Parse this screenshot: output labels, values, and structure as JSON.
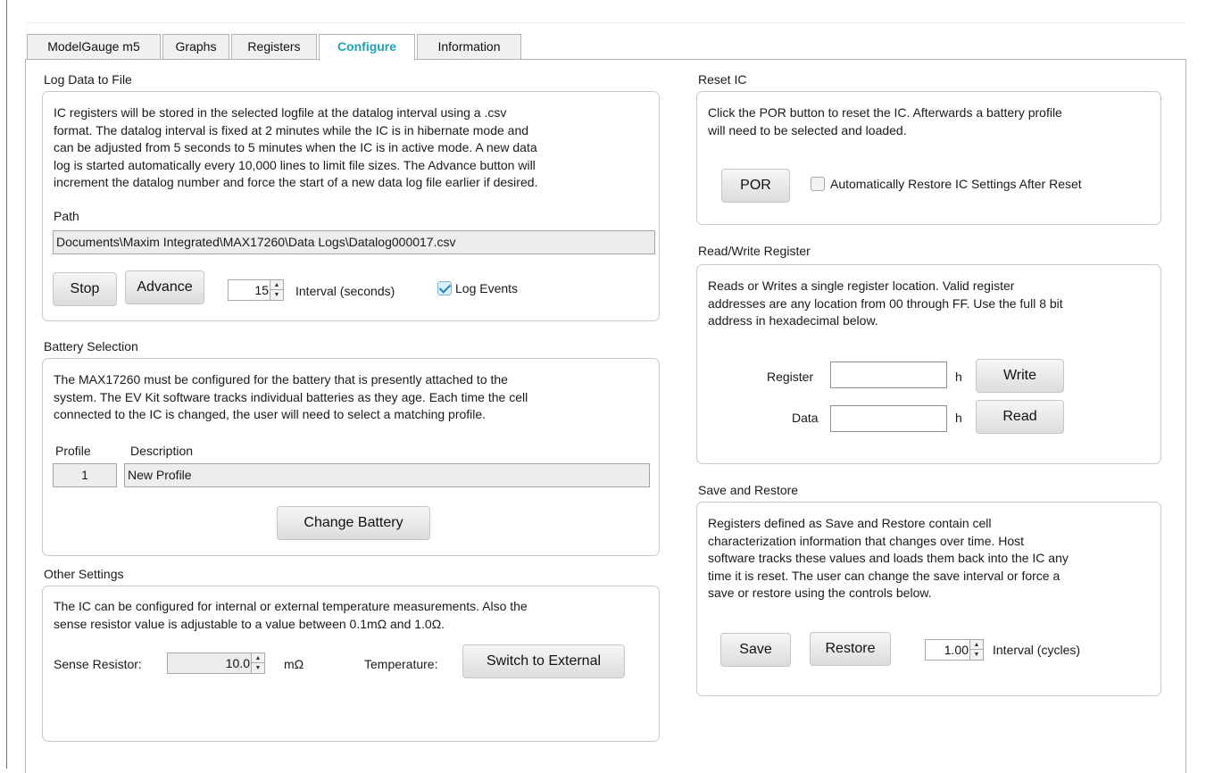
{
  "tabs": [
    "ModelGauge m5",
    "Graphs",
    "Registers",
    "Configure",
    "Information"
  ],
  "active_tab": "Configure",
  "log": {
    "title": "Log Data to File",
    "lines": [
      "IC registers will be stored in the selected logfile at the datalog interval using a .csv",
      "format. The datalog interval is fixed at 2 minutes while the IC is in hibernate mode and",
      "can be adjusted from 5 seconds to 5 minutes when the IC is in active mode. A new data",
      "log is started automatically every 10,000 lines to limit file sizes. The Advance button will",
      "increment the datalog number and force the start of a new data log file earlier if desired."
    ],
    "path_label": "Path",
    "path_value": "Documents\\Maxim Integrated\\MAX17260\\Data Logs\\Datalog000017.csv",
    "stop_label": "Stop",
    "advance_label": "Advance",
    "interval_value": "15",
    "interval_label": "Interval (seconds)",
    "log_events_label": "Log Events",
    "log_events_checked": true
  },
  "battery": {
    "title": "Battery Selection",
    "lines": [
      "The MAX17260 must be configured for the battery that is presently attached to the",
      "system. The EV Kit software tracks individual batteries as they age. Each time the cell",
      "connected to the IC is changed, the user will need to select a matching profile."
    ],
    "profile_header": "Profile",
    "description_header": "Description",
    "profile_value": "1",
    "description_value": "New Profile",
    "change_label": "Change Battery"
  },
  "other": {
    "title": "Other Settings",
    "lines": [
      "The IC can be configured for internal or external temperature measurements. Also the",
      "sense resistor value is adjustable to a value between 0.1mΩ and 1.0Ω."
    ],
    "sense_label": "Sense Resistor:",
    "sense_value": "10.0",
    "sense_unit": "mΩ",
    "temp_label": "Temperature:",
    "switch_label": "Switch to External"
  },
  "reset": {
    "title": "Reset IC",
    "lines": [
      "Click the POR button to reset the IC. Afterwards a battery profile",
      "will need to be selected and loaded."
    ],
    "por_label": "POR",
    "auto_restore_label": "Automatically Restore IC Settings After Reset",
    "auto_restore_checked": false
  },
  "rw": {
    "title": "Read/Write Register",
    "lines": [
      "Reads or Writes a single register location. Valid register",
      "addresses are any location from 00 through FF. Use the full 8 bit",
      "address in hexadecimal below."
    ],
    "register_label": "Register",
    "register_value": "",
    "data_label": "Data",
    "data_value": "",
    "h_suffix": "h",
    "write_label": "Write",
    "read_label": "Read"
  },
  "save": {
    "title": "Save and Restore",
    "lines": [
      "Registers defined as Save and Restore contain cell",
      "characterization information that changes over time. Host",
      "software tracks these values and loads them back into the IC any",
      "time it is reset. The user can change the save interval or force a",
      "save or restore using the controls below."
    ],
    "save_label": "Save",
    "restore_label": "Restore",
    "interval_value": "1.00",
    "interval_label": "Interval (cycles)"
  }
}
